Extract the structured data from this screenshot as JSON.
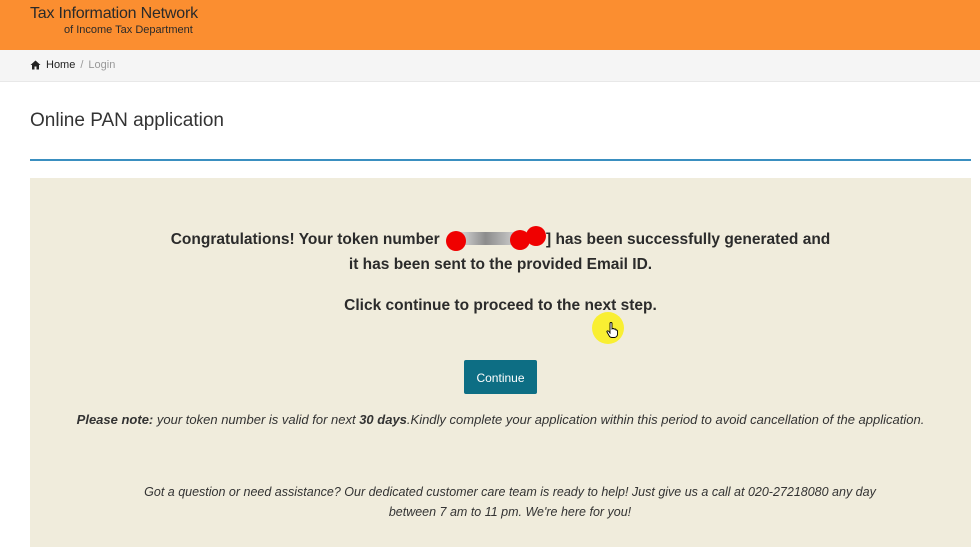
{
  "header": {
    "title": "Tax Information Network",
    "subtitle": "of Income Tax Department",
    "background_color": "#fb8e30"
  },
  "breadcrumb": {
    "home_icon": "home-icon",
    "home": "Home",
    "separator": "/",
    "current": "Login"
  },
  "page": {
    "title": "Online PAN application"
  },
  "message": {
    "line1_before": "Congratulations! Your token number",
    "line1_after": "] has been successfully generated and",
    "line2": "it has been sent to the provided Email ID.",
    "line3": "Click continue to proceed to the next step."
  },
  "continue_button": {
    "label": "Continue",
    "color": "#0d6e84"
  },
  "note": {
    "label": "Please note:",
    "text_before": " your token number is valid for next ",
    "days": "30 days",
    "text_after": ".Kindly complete your application within this period to avoid cancellation of the application."
  },
  "help": {
    "line1": "Got a question or need assistance? Our dedicated customer care team is ready to help! Just give us a call at 020-27218080 any day",
    "line2": "between 7 am to 11 pm. We're here for you!"
  }
}
